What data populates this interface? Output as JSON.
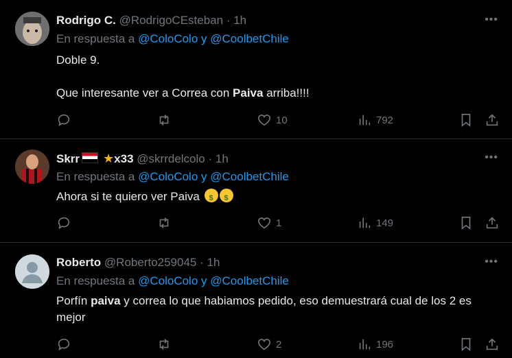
{
  "tweets": [
    {
      "name": "Rodrigo C.",
      "handle": "@RodrigoCEsteban",
      "time": "1h",
      "reply_prefix": "En respuesta a",
      "mention1": "@ColoColo",
      "reply_join": "y",
      "mention2": "@CoolbetChile",
      "line1": "Doble 9.",
      "line2_a": "Que interesante ver a Correa con ",
      "line2_b": "Paiva",
      "line2_c": " arriba!!!!",
      "likes": "10",
      "views": "792"
    },
    {
      "name": "Skrr",
      "name_suffix": "x33",
      "handle": "@skrrdelcolo",
      "time": "1h",
      "reply_prefix": "En respuesta a",
      "mention1": "@ColoColo",
      "reply_join": "y",
      "mention2": "@CoolbetChile",
      "text": "Ahora si te quiero ver Paiva",
      "likes": "1",
      "views": "149"
    },
    {
      "name": "Roberto",
      "handle": "@Roberto259045",
      "time": "1h",
      "reply_prefix": "En respuesta a",
      "mention1": "@ColoColo",
      "reply_join": "y",
      "mention2": "@CoolbetChile",
      "text_a": "Porfín ",
      "text_b": "paiva",
      "text_c": " y correa lo que habiamos pedido, eso demuestrará cual de los 2 es mejor",
      "likes": "2",
      "views": "196"
    }
  ],
  "separator": "·",
  "more_glyph": "•••",
  "icons": [
    "reply-icon",
    "retweet-icon",
    "like-icon",
    "views-icon",
    "bookmark-icon",
    "share-icon"
  ],
  "colors": {
    "link": "#1d9bf0",
    "muted": "#71767b",
    "text": "#e7e9ea",
    "divider": "#2f3336"
  }
}
